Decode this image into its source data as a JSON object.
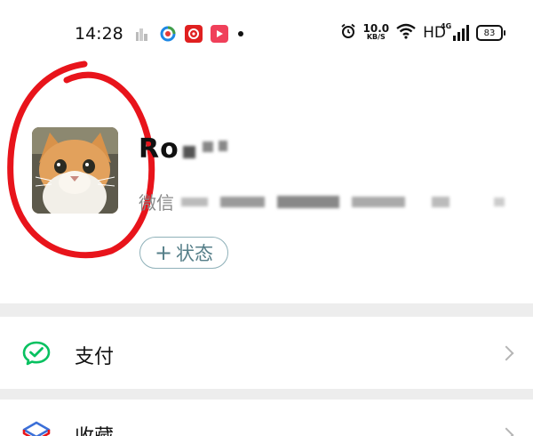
{
  "status_bar": {
    "time": "14:28",
    "net_speed_value": "10.0",
    "net_speed_unit": "KB/S",
    "hd": "HD",
    "signal_label": "4G",
    "battery": "83"
  },
  "profile": {
    "name_visible": "Ro",
    "wechat_id_label": "微信",
    "status_plus": "+",
    "status_label": "状态"
  },
  "menu": {
    "items": [
      {
        "label": "支付",
        "icon": "wechat-pay-icon"
      },
      {
        "label": "收藏",
        "icon": "favorites-icon"
      }
    ]
  },
  "colors": {
    "accent_green": "#07c160",
    "annotation_red": "#e8141b",
    "status_button_text": "#567f89",
    "separator": "#ededed"
  }
}
